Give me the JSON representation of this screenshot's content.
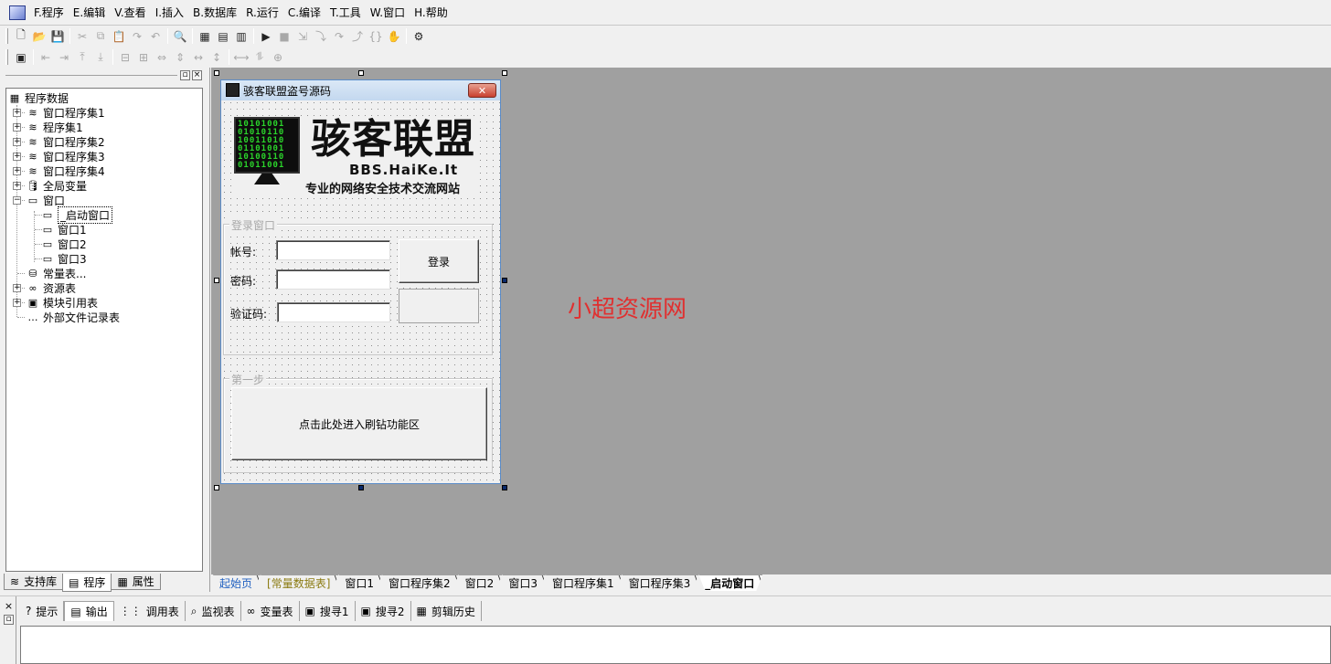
{
  "menu": [
    "F.程序",
    "E.编辑",
    "V.查看",
    "I.插入",
    "B.数据库",
    "R.运行",
    "C.编译",
    "T.工具",
    "W.窗口",
    "H.帮助"
  ],
  "toolbar1_icons": [
    "new-file-icon",
    "open-folder-icon",
    "save-icon",
    "cut-icon",
    "copy-icon",
    "paste-icon",
    "redo-icon",
    "undo-icon",
    "find-icon",
    "layout-1-icon",
    "layout-2-icon",
    "layout-3-icon",
    "run-icon",
    "stop-icon",
    "step-icon",
    "step-into-icon",
    "step-over-icon",
    "step-out-icon",
    "run-to-cursor-icon",
    "hand-icon",
    "debug-icon"
  ],
  "toolbar2_icons": [
    "form-icon",
    "align-left-icon",
    "align-right-icon",
    "align-top-icon",
    "align-bottom-icon",
    "center-h-icon",
    "center-v-icon",
    "same-width-icon",
    "same-height-icon",
    "h-space-icon",
    "v-space-icon",
    "fit-width-icon",
    "fit-height-icon",
    "fit-both-icon"
  ],
  "tree": {
    "root": "程序数据",
    "items": [
      {
        "label": "窗口程序集1",
        "icon": "assembly-icon",
        "expandable": true
      },
      {
        "label": "程序集1",
        "icon": "assembly-icon",
        "expandable": true
      },
      {
        "label": "窗口程序集2",
        "icon": "assembly-icon",
        "expandable": true
      },
      {
        "label": "窗口程序集3",
        "icon": "assembly-icon",
        "expandable": true
      },
      {
        "label": "窗口程序集4",
        "icon": "assembly-icon",
        "expandable": true
      },
      {
        "label": "全局变量",
        "icon": "global-var-icon",
        "expandable": true
      },
      {
        "label": "窗口",
        "icon": "window-icon",
        "expandable": true,
        "expanded": true
      },
      {
        "label": "_启动窗口",
        "icon": "window-icon",
        "selected": true
      },
      {
        "label": "窗口1",
        "icon": "window-icon"
      },
      {
        "label": "窗口2",
        "icon": "window-icon"
      },
      {
        "label": "窗口3",
        "icon": "window-icon"
      },
      {
        "label": "常量表...",
        "icon": "constant-icon"
      },
      {
        "label": "资源表",
        "icon": "resource-icon",
        "expandable": true
      },
      {
        "label": "模块引用表",
        "icon": "module-icon",
        "expandable": true
      },
      {
        "label": "外部文件记录表",
        "icon": "external-file-icon"
      }
    ]
  },
  "left_tabs": [
    "支持库",
    "程序",
    "属性"
  ],
  "form": {
    "title": "骇客联盟盗号源码",
    "close_label": "✕",
    "banner_title": "骇客联盟",
    "banner_url": "BBS.HaiKe.It",
    "banner_slogan": "专业的网络安全技术交流网站",
    "banner_matrix": "10101001\n01010110\n10011010\n01101001\n10100110\n01011001",
    "login_group": "登录窗口",
    "account_label": "帐号:",
    "password_label": "密码:",
    "captcha_label": "验证码:",
    "login_button": "登录",
    "step_group": "第一步",
    "step_button": "点击此处进入刷钻功能区"
  },
  "watermark": "小超资源网",
  "doc_tabs": [
    {
      "label": "起始页",
      "color": "#2060c0"
    },
    {
      "label": "[常量数据表]",
      "color": "#8a7a10"
    },
    {
      "label": "窗口1"
    },
    {
      "label": "窗口程序集2"
    },
    {
      "label": "窗口2"
    },
    {
      "label": "窗口3"
    },
    {
      "label": "窗口程序集1"
    },
    {
      "label": "窗口程序集3"
    },
    {
      "label": "_启动窗口",
      "active": true
    }
  ],
  "output_tabs": [
    {
      "label": "提示",
      "icon": "hint-icon",
      "glyph": "?"
    },
    {
      "label": "输出",
      "icon": "output-icon",
      "glyph": "▤",
      "active": true
    },
    {
      "label": "调用表",
      "icon": "call-stack-icon",
      "glyph": "⋮⋮"
    },
    {
      "label": "监视表",
      "icon": "watch-icon",
      "glyph": "⌕"
    },
    {
      "label": "变量表",
      "icon": "variable-icon",
      "glyph": "∞"
    },
    {
      "label": "搜寻1",
      "icon": "search1-icon",
      "glyph": "▣"
    },
    {
      "label": "搜寻2",
      "icon": "search2-icon",
      "glyph": "▣"
    },
    {
      "label": "剪辑历史",
      "icon": "clip-history-icon",
      "glyph": "▦"
    }
  ],
  "panel_buttons": {
    "restore": "▫",
    "close": "×"
  }
}
